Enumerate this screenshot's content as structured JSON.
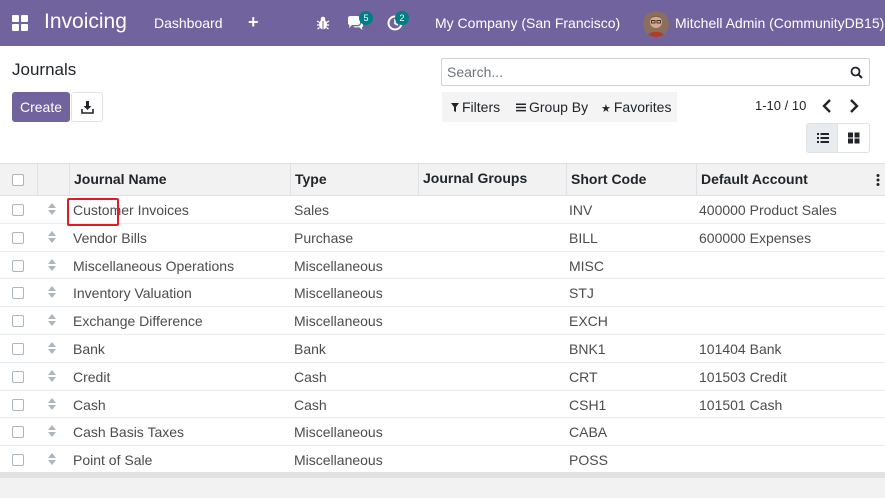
{
  "navbar": {
    "app_name": "Invoicing",
    "menu": [
      "Dashboard"
    ],
    "plus": "+",
    "chat_count": "5",
    "activity_count": "2",
    "company": "My Company (San Francisco)",
    "user": "Mitchell Admin (CommunityDB15)",
    "brand_color": "#71639e"
  },
  "control_panel": {
    "title": "Journals",
    "create_label": "Create",
    "search_placeholder": "Search...",
    "filters_label": "Filters",
    "group_by_label": "Group By",
    "favorites_label": "Favorites",
    "pager": "1-10 / 10"
  },
  "table": {
    "columns": [
      "Journal Name",
      "Type",
      "Journal Groups",
      "Short Code",
      "Default Account"
    ],
    "rows": [
      {
        "name": "Customer Invoices",
        "type": "Sales",
        "groups": "",
        "code": "INV",
        "account": "400000 Product Sales"
      },
      {
        "name": "Vendor Bills",
        "type": "Purchase",
        "groups": "",
        "code": "BILL",
        "account": "600000 Expenses"
      },
      {
        "name": "Miscellaneous Operations",
        "type": "Miscellaneous",
        "groups": "",
        "code": "MISC",
        "account": ""
      },
      {
        "name": "Inventory Valuation",
        "type": "Miscellaneous",
        "groups": "",
        "code": "STJ",
        "account": ""
      },
      {
        "name": "Exchange Difference",
        "type": "Miscellaneous",
        "groups": "",
        "code": "EXCH",
        "account": ""
      },
      {
        "name": "Bank",
        "type": "Bank",
        "groups": "",
        "code": "BNK1",
        "account": "101404 Bank"
      },
      {
        "name": "Credit",
        "type": "Cash",
        "groups": "",
        "code": "CRT",
        "account": "101503 Credit"
      },
      {
        "name": "Cash",
        "type": "Cash",
        "groups": "",
        "code": "CSH1",
        "account": "101501 Cash"
      },
      {
        "name": "Cash Basis Taxes",
        "type": "Miscellaneous",
        "groups": "",
        "code": "CABA",
        "account": ""
      },
      {
        "name": "Point of Sale",
        "type": "Miscellaneous",
        "groups": "",
        "code": "POSS",
        "account": ""
      }
    ]
  }
}
